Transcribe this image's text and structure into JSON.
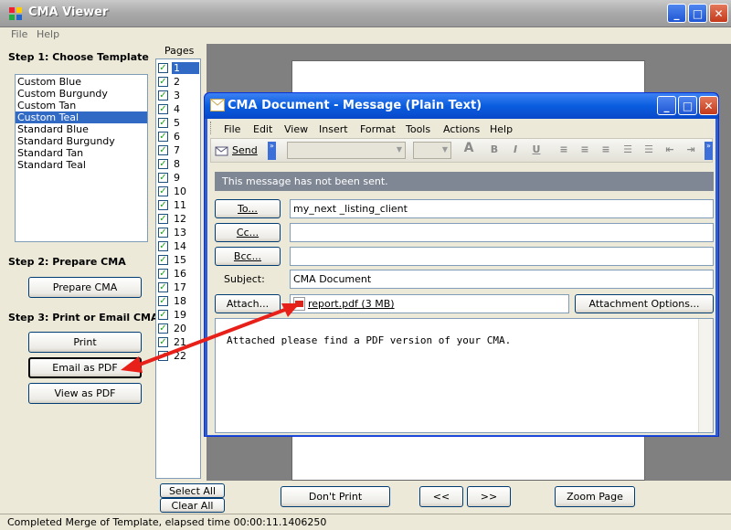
{
  "app": {
    "title": "CMA Viewer"
  },
  "menu": [
    "File",
    "Help"
  ],
  "steps": {
    "step1": "Step 1: Choose Template",
    "step2": "Step 2: Prepare CMA",
    "step3": "Step 3: Print or Email CMA"
  },
  "templates": [
    "Custom Blue",
    "Custom Burgundy",
    "Custom Tan",
    "Custom Teal",
    "Standard Blue",
    "Standard Burgundy",
    "Standard Tan",
    "Standard Teal"
  ],
  "selected_template": "Custom Teal",
  "buttons": {
    "prepare": "Prepare CMA",
    "print": "Print",
    "email_pdf": "Email as PDF",
    "view_pdf": "View as PDF",
    "select_all": "Select All",
    "clear_all": "Clear All",
    "dont_print": "Don't Print",
    "prev": "<<",
    "next": ">>",
    "zoom": "Zoom Page"
  },
  "pages": {
    "label": "Pages",
    "items": [
      "1",
      "2",
      "3",
      "4",
      "5",
      "6",
      "7",
      "8",
      "9",
      "10",
      "11",
      "12",
      "13",
      "14",
      "15",
      "16",
      "17",
      "18",
      "19",
      "20",
      "21",
      "22"
    ],
    "selected": "1"
  },
  "message": {
    "title": "CMA Document - Message (Plain Text)",
    "menu": [
      "File",
      "Edit",
      "View",
      "Insert",
      "Format",
      "Tools",
      "Actions",
      "Help"
    ],
    "send": "Send",
    "info": "This message has not been sent.",
    "to_label": "To...",
    "cc_label": "Cc...",
    "bcc_label": "Bcc...",
    "subject_label": "Subject:",
    "attach_label": "Attach...",
    "to_value": "my_next _listing_client",
    "cc_value": "",
    "bcc_value": "",
    "subject_value": "CMA Document",
    "attachment": "report.pdf (3 MB)",
    "attachment_options": "Attachment Options...",
    "body": "Attached please find a PDF version of your CMA."
  },
  "status": "Completed Merge of Template, elapsed time 00:00:11.1406250",
  "colors": {
    "selection": "#316ac5",
    "arrow": "#e8201a",
    "title_blue": "#0a5ddf"
  }
}
